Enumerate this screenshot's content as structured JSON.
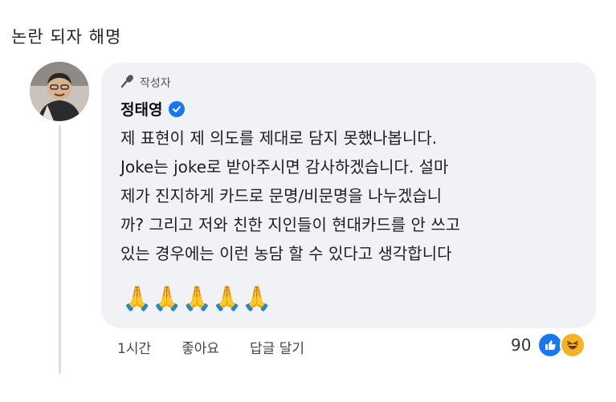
{
  "post": {
    "title": "논란 되자 해명"
  },
  "comment": {
    "badge_label": "작성자",
    "author": "정태영",
    "lines": [
      "제 표현이 제 의도를 제대로 담지 못했나봅니다.",
      "Joke는 joke로 받아주시면 감사하겠습니다. 설마",
      "제가 진지하게 카드로 문명/비문명을 나누겠습니",
      "까? 그리고 저와 친한 지인들이 현대카드를 안 쓰고",
      "있는 경우에는 이런 농담 할 수 있다고 생각합니다"
    ],
    "emojis": "🙏🙏🙏🙏🙏"
  },
  "actions": {
    "time": "1시간",
    "like": "좋아요",
    "reply": "답글 달기"
  },
  "reactions": {
    "count": "90",
    "types": [
      "like-icon",
      "haha-icon"
    ]
  },
  "colors": {
    "bubble": "#f0f2f5",
    "verified": "#1877f2",
    "like": "#1877f2",
    "haha": "#f7b125"
  }
}
